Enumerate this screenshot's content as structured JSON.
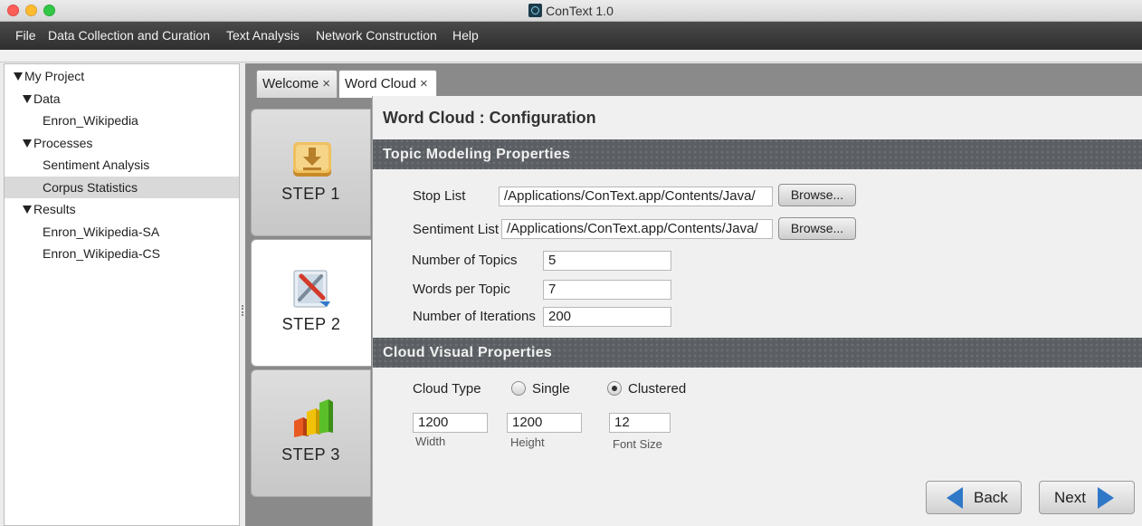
{
  "window": {
    "title": "ConText 1.0"
  },
  "menu": [
    "File",
    "Data Collection and Curation",
    "Text Analysis",
    "Network Construction",
    "Help"
  ],
  "tree": {
    "root": "My Project",
    "data_folder": "Data",
    "data_item": "Enron_Wikipedia",
    "processes_folder": "Processes",
    "process_1": "Sentiment Analysis",
    "process_2": "Corpus Statistics",
    "results_folder": "Results",
    "result_1": "Enron_Wikipedia-SA",
    "result_2": "Enron_Wikipedia-CS"
  },
  "tabs": {
    "welcome": "Welcome",
    "wordcloud": "Word Cloud",
    "close_glyph": "×"
  },
  "steps": {
    "step1": "STEP 1",
    "step2": "STEP 2",
    "step3": "STEP 3"
  },
  "page": {
    "title": "Word Cloud : Configuration"
  },
  "topic": {
    "header": "Topic Modeling Properties",
    "stop_list_label": "Stop List",
    "stop_list_value": "/Applications/ConText.app/Contents/Java/",
    "sentiment_list_label": "Sentiment List",
    "sentiment_list_value": "/Applications/ConText.app/Contents/Java/",
    "browse": "Browse...",
    "num_topics_label": "Number of Topics",
    "num_topics_value": "5",
    "words_per_topic_label": "Words per Topic",
    "words_per_topic_value": "7",
    "num_iterations_label": "Number of Iterations",
    "num_iterations_value": "200"
  },
  "cloud": {
    "header": "Cloud Visual Properties",
    "type_label": "Cloud Type",
    "single": "Single",
    "clustered": "Clustered",
    "width_value": "1200",
    "width_label": "Width",
    "height_value": "1200",
    "height_label": "Height",
    "font_size_value": "12",
    "font_size_label": "Font Size"
  },
  "nav": {
    "back": "Back",
    "next": "Next"
  },
  "colors": {
    "section_bg": "#5b5f63",
    "menubar_bg": "#3a3a3a",
    "arrow": "#2f78c8"
  }
}
